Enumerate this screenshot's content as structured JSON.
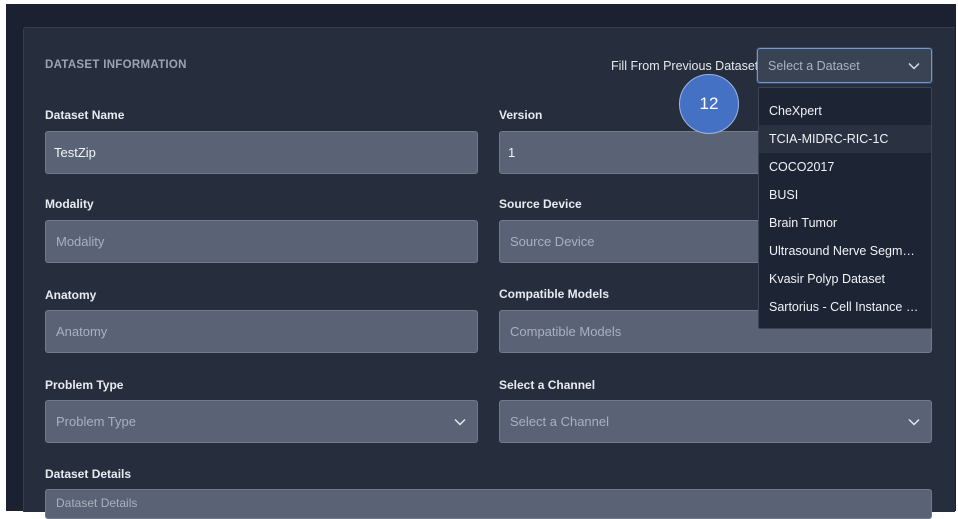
{
  "section": {
    "title": "DATASET INFORMATION",
    "fill_label": "Fill From Previous Dataset",
    "dataset_select_placeholder": "Select a Dataset"
  },
  "dropdown": {
    "items": [
      "CheXpert",
      "TCIA-MIDRC-RIC-1C",
      "COCO2017",
      "BUSI",
      "Brain Tumor",
      "Ultrasound Nerve Segmen...",
      "Kvasir Polyp Dataset",
      "Sartorius - Cell Instance S..."
    ],
    "highlighted_index": 1
  },
  "step_badge": "12",
  "form": {
    "dataset_name": {
      "label": "Dataset Name",
      "value": "TestZip"
    },
    "version": {
      "label": "Version",
      "value": "1"
    },
    "modality": {
      "label": "Modality",
      "placeholder": "Modality"
    },
    "source_device": {
      "label": "Source Device",
      "placeholder": "Source Device"
    },
    "anatomy": {
      "label": "Anatomy",
      "placeholder": "Anatomy"
    },
    "compatible_models": {
      "label": "Compatible Models",
      "placeholder": "Compatible Models"
    },
    "problem_type": {
      "label": "Problem Type",
      "placeholder": "Problem Type"
    },
    "channel": {
      "label": "Select a Channel",
      "placeholder": "Select a Channel"
    },
    "dataset_details": {
      "label": "Dataset Details",
      "placeholder": "Dataset Details"
    }
  },
  "colors": {
    "background": "#1b2130",
    "panel": "#262e3d",
    "field": "#5a6375",
    "accent": "#4571c4"
  }
}
